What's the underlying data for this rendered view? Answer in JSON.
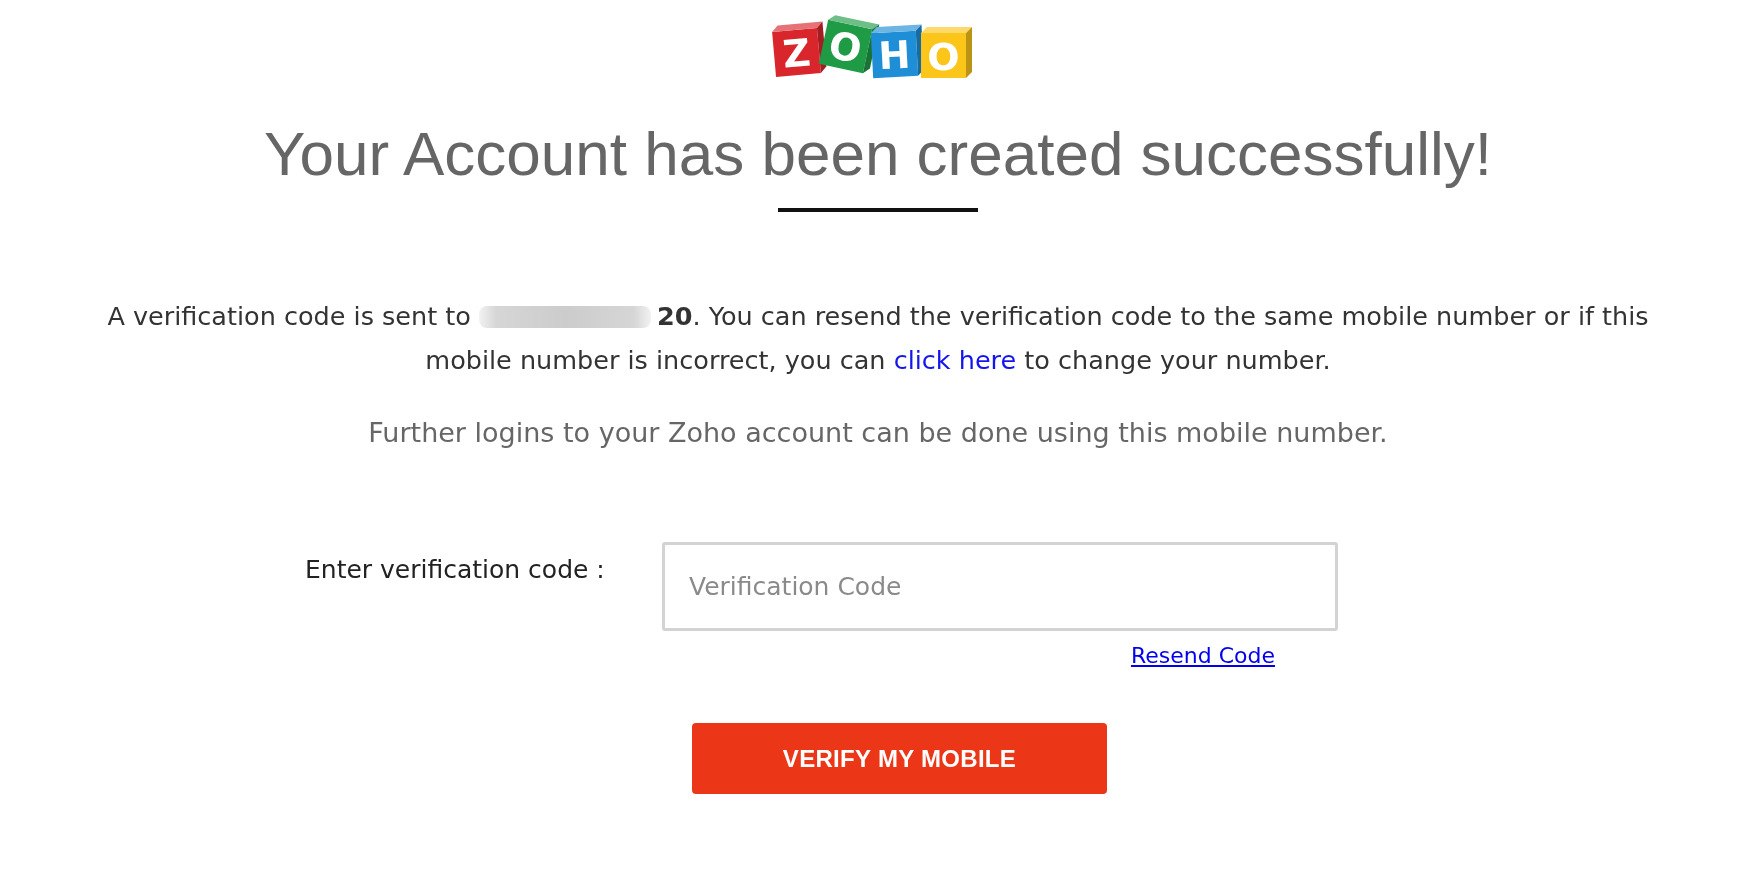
{
  "logo": {
    "tiles": [
      {
        "letter": "Z",
        "color": "#d9262c"
      },
      {
        "letter": "O",
        "color": "#1f9b46"
      },
      {
        "letter": "H",
        "color": "#1e8fd6"
      },
      {
        "letter": "O",
        "color": "#fbc51a"
      }
    ]
  },
  "heading": "Your Account has been created successfully!",
  "message": [
    {
      "kind": "text",
      "text": "A verification code is sent to "
    },
    {
      "kind": "redacted"
    },
    {
      "kind": "text",
      "text": "**20**. You can resend the verification code to the same mobile number or if this mobile number is incorrect, you can "
    },
    {
      "kind": "link",
      "text": "click here"
    },
    {
      "kind": "text",
      "text": " to change your number."
    }
  ],
  "note": "Further logins to your Zoho account can be done using this mobile number.",
  "form": {
    "label": "Enter verification code :",
    "field": {
      "placeholder": "Verification Code"
    },
    "resend_link": "Resend Code",
    "button": "VERIFY MY MOBILE"
  }
}
